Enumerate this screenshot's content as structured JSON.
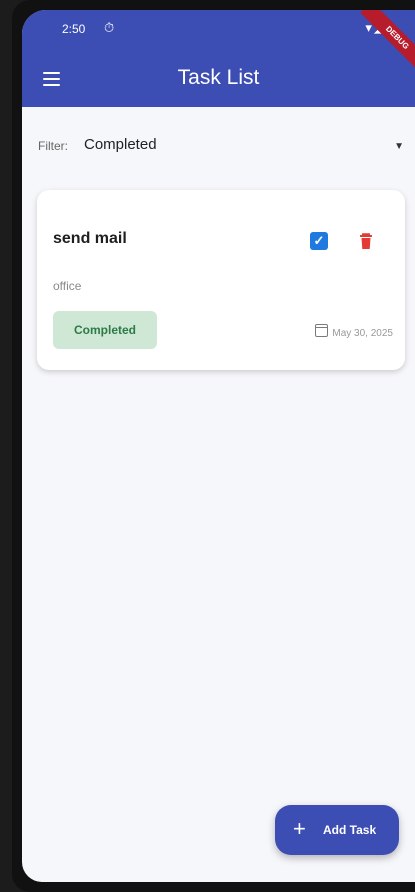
{
  "status_bar": {
    "time": "2:50",
    "alarm_icon": "alarm-icon",
    "right_icons": "wifi-signal-battery-icons"
  },
  "app_bar": {
    "title": "Task List",
    "menu_icon": "menu-icon",
    "background_color": "#3c4db4"
  },
  "filter": {
    "label": "Filter:",
    "value": "Completed"
  },
  "tasks": [
    {
      "title": "send mail",
      "category": "office",
      "completed": true,
      "status": "Completed",
      "date": "May 30, 2025"
    }
  ],
  "fab": {
    "label": "Add Task",
    "icon": "plus-icon"
  },
  "colors": {
    "primary": "#3c4db4",
    "checkbox": "#1f7ae0",
    "delete": "#e53935",
    "completed_chip_bg": "#cfe8d5",
    "completed_chip_text": "#2c7a44"
  }
}
